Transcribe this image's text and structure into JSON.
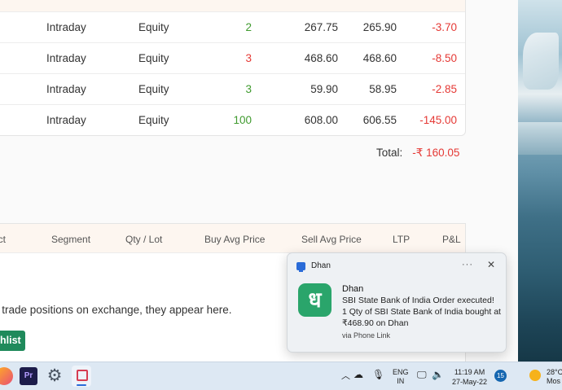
{
  "positions": {
    "rows": [
      {
        "product": "Intraday",
        "segment": "Equity",
        "qty": "2",
        "qty_color": "pos",
        "buy_avg": "267.75",
        "sell_avg": "265.90",
        "pnl": "-3.70"
      },
      {
        "product": "Intraday",
        "segment": "Equity",
        "qty": "3",
        "qty_color": "neg",
        "buy_avg": "468.60",
        "sell_avg": "468.60",
        "pnl": "-8.50"
      },
      {
        "product": "Intraday",
        "segment": "Equity",
        "qty": "3",
        "qty_color": "pos",
        "buy_avg": "59.90",
        "sell_avg": "58.95",
        "pnl": "-2.85"
      },
      {
        "product": "Intraday",
        "segment": "Equity",
        "qty": "100",
        "qty_color": "pos",
        "buy_avg": "608.00",
        "sell_avg": "606.55",
        "pnl": "-145.00"
      }
    ],
    "total_label": "Total:",
    "total_value": "-₹ 160.05"
  },
  "empty_table": {
    "headers": {
      "product": "uct",
      "segment": "Segment",
      "qty": "Qty / Lot",
      "buy_avg": "Buy Avg Price",
      "sell_avg": "Sell Avg Price",
      "ltp": "LTP",
      "pnl": "P&L"
    },
    "message": "n trade positions on exchange, they appear here.",
    "watchlist_button": "hlist"
  },
  "notification": {
    "app_name": "Dhan",
    "more_icon": "more-icon",
    "close_icon": "close-icon",
    "logo_glyph": "ध",
    "title": "Dhan",
    "line1": "SBI State Bank of India Order executed!",
    "line2": "1 Qty of SBI State Bank of India bought at ₹468.90 on Dhan",
    "footer": "via Phone Link"
  },
  "taskbar": {
    "apps": [
      "avatar-app-icon",
      "premiere-pro-icon",
      "settings-gear-icon",
      "snipping-tool-icon"
    ],
    "premiere_label": "Pr",
    "lang_line1": "ENG",
    "lang_line2": "IN",
    "time": "11:19 AM",
    "date": "27-May-22",
    "notification_count": "15",
    "temperature": "28°C",
    "weather_text": "Mos"
  },
  "colors": {
    "positive": "#3f9a2e",
    "negative": "#e53935",
    "accent_green": "#1f8a5b",
    "dhan_logo": "#2aa56b"
  }
}
